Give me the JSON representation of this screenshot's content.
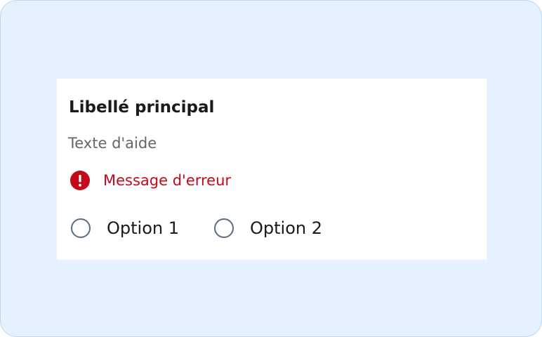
{
  "field": {
    "label": "Libellé principal",
    "hint": "Texte d'aide",
    "error": {
      "icon": "error-alert-icon",
      "message": "Message d'erreur",
      "color": "#c4091a"
    },
    "options": [
      {
        "label": "Option 1",
        "selected": false
      },
      {
        "label": "Option 2",
        "selected": false
      }
    ]
  },
  "colors": {
    "background": "#e5f1ff",
    "card": "#ffffff",
    "radio_border": "#596e82"
  }
}
